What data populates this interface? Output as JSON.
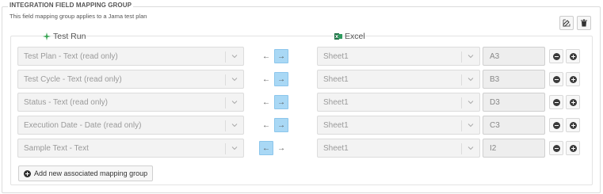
{
  "group": {
    "title": "INTEGRATION FIELD MAPPING GROUP",
    "subtitle": "This field mapping group applies to a Jama test plan"
  },
  "columns": {
    "left_label": "Test Run",
    "left_icon": "sparkle-icon",
    "right_label": "Excel",
    "right_icon": "excel-icon"
  },
  "arrows": {
    "left": "←",
    "right": "→"
  },
  "rows": [
    {
      "field": "Test Plan - Text (read only)",
      "sheet": "Sheet1",
      "cell": "A3",
      "direction": "right"
    },
    {
      "field": "Test Cycle - Text (read only)",
      "sheet": "Sheet1",
      "cell": "B3",
      "direction": "right"
    },
    {
      "field": "Status - Text (read only)",
      "sheet": "Sheet1",
      "cell": "D3",
      "direction": "right"
    },
    {
      "field": "Execution Date - Date (read only)",
      "sheet": "Sheet1",
      "cell": "C3",
      "direction": "right"
    },
    {
      "field": "Sample Text - Text",
      "sheet": "Sheet1",
      "cell": "I2",
      "direction": "left"
    }
  ],
  "actions": {
    "add_label": "Add new associated mapping group"
  },
  "colors": {
    "active_arrow": "#a9d8f5",
    "excel_green": "#1e7145",
    "sparkle_green": "#3aa655"
  }
}
